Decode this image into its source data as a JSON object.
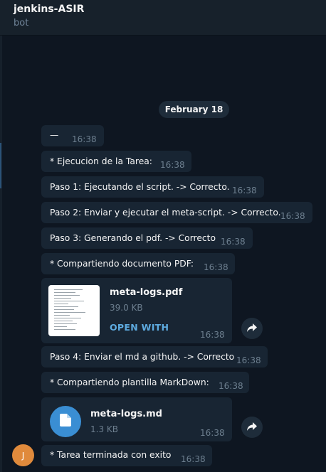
{
  "header": {
    "title": "jenkins-ASIR",
    "subtitle": "bot"
  },
  "date_divider": "February 18",
  "messages": [
    {
      "text": "—",
      "time": "16:38"
    },
    {
      "text": "* Ejecucion de la Tarea:",
      "time": "16:38"
    },
    {
      "text": "Paso 1: Ejecutando el script. -> Correcto.",
      "time": "16:38"
    },
    {
      "text": "Paso 2: Enviar y ejecutar el meta-script. -> Correcto.",
      "time": "16:38"
    },
    {
      "text": "Paso 3: Generando el pdf. -> Correcto",
      "time": "16:38"
    },
    {
      "text": "* Compartiendo documento PDF:",
      "time": "16:38"
    },
    {
      "text": "Paso 4: Enviar el md a github. -> Correcto",
      "time": "16:38"
    },
    {
      "text": "* Compartiendo plantilla MarkDown:",
      "time": "16:38"
    },
    {
      "text": "* Tarea terminada con exito",
      "time": "16:38"
    }
  ],
  "files": {
    "pdf": {
      "name": "meta-logs.pdf",
      "size": "39.0 KB",
      "action": "OPEN WITH",
      "time": "16:38"
    },
    "md": {
      "name": "meta-logs.md",
      "size": "1.3 KB",
      "time": "16:38"
    }
  },
  "avatar_initial": "J",
  "colors": {
    "background": "#0e1621",
    "bubble": "#182533",
    "accent": "#5eabe0",
    "doc_icon": "#3a8ed3",
    "avatar": "#e08a3c"
  },
  "icons": [
    "share-arrow-icon",
    "document-icon"
  ]
}
